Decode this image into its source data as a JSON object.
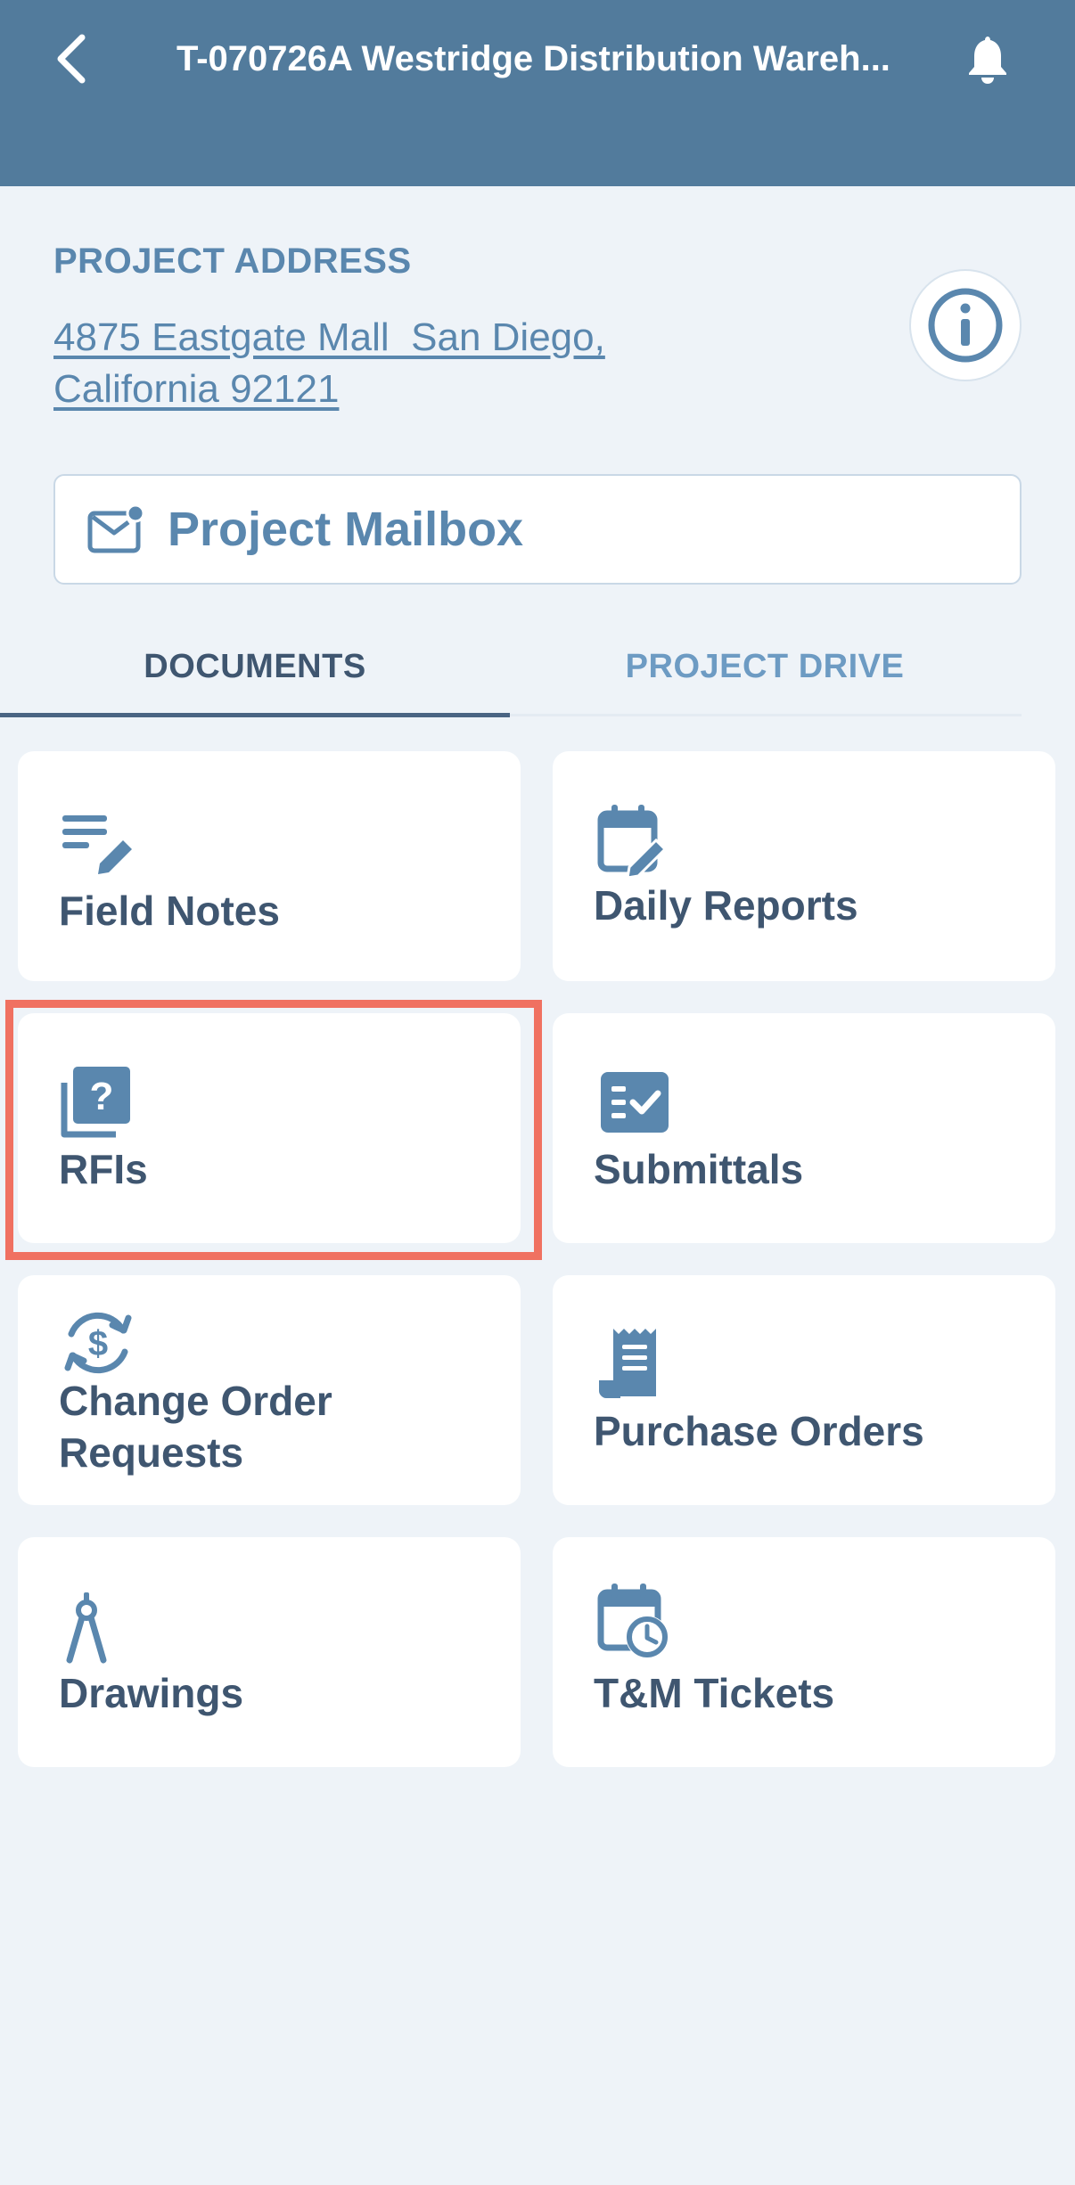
{
  "header": {
    "title": "T-070726A Westridge Distribution Wareh...",
    "back_icon": "chevron-left-icon",
    "bell_icon": "bell-icon",
    "background": "#527b9c"
  },
  "project": {
    "address_label": "PROJECT ADDRESS",
    "address_line1": "4875 Eastgate Mall  San Diego,",
    "address_line2": "California 92121",
    "info_icon": "info-icon"
  },
  "mailbox": {
    "label": "Project Mailbox",
    "icon": "mail-notification-icon"
  },
  "tabs": [
    {
      "label": "DOCUMENTS",
      "active": true
    },
    {
      "label": "PROJECT DRIVE",
      "active": false
    }
  ],
  "cards": [
    {
      "label": "Field Notes",
      "icon": "notes-edit-icon"
    },
    {
      "label": "Daily Reports",
      "icon": "calendar-edit-icon"
    },
    {
      "label": "RFIs",
      "icon": "question-stack-icon",
      "highlighted": true
    },
    {
      "label": "Submittals",
      "icon": "checklist-icon"
    },
    {
      "label": "Change Order Requests",
      "icon": "dollar-cycle-icon"
    },
    {
      "label": "Purchase Orders",
      "icon": "receipt-icon"
    },
    {
      "label": "Drawings",
      "icon": "compass-drafting-icon"
    },
    {
      "label": "T&M Tickets",
      "icon": "calendar-clock-icon"
    }
  ],
  "colors": {
    "accent": "#5a87ae",
    "text_dark": "#3f5670",
    "highlight": "#f07161",
    "background": "#eef3f8"
  }
}
